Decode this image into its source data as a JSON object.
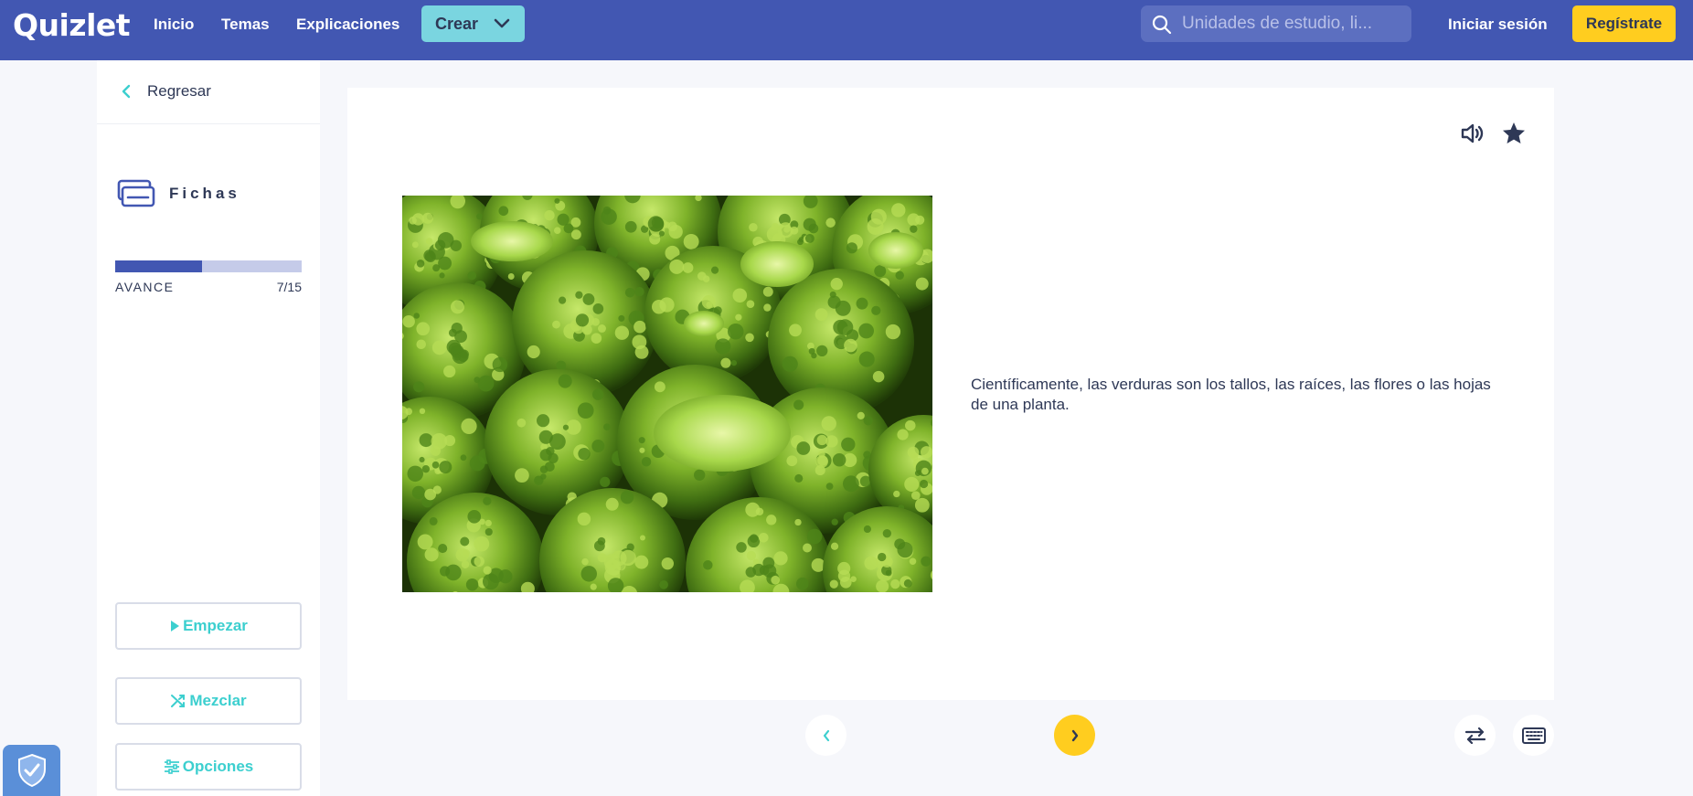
{
  "header": {
    "logo": "Quizlet",
    "nav": [
      "Inicio",
      "Temas",
      "Explicaciones"
    ],
    "create_label": "Crear",
    "search_placeholder": "Unidades de estudio, li...",
    "login_label": "Iniciar sesión",
    "register_label": "Regístrate"
  },
  "sidebar": {
    "back_label": "Regresar",
    "mode_title": "Fichas",
    "progress": {
      "label": "AVANCE",
      "current": 7,
      "total": 15,
      "count_text": "7/15"
    },
    "buttons": {
      "start": "Empezar",
      "shuffle": "Mezclar",
      "options": "Opciones"
    }
  },
  "card": {
    "definition": "Científicamente, las verduras son los tallos, las raíces, las flores o las hojas de una planta.",
    "image_subject": "broccoli florets"
  },
  "icons": {
    "search": "search-icon",
    "chevron": "chevron-down-icon",
    "back": "chevron-left-icon",
    "mode": "flashcards-icon",
    "audio": "speaker-icon",
    "star": "star-icon",
    "prev": "chevron-left-icon",
    "next": "chevron-right-icon",
    "swap": "swap-icon",
    "keyboard": "keyboard-icon",
    "shield": "shield-check-icon"
  },
  "colors": {
    "brand": "#4257b2",
    "accent_teal": "#3ccfcf",
    "accent_yellow": "#ffcd1f",
    "text": "#2e3856"
  }
}
